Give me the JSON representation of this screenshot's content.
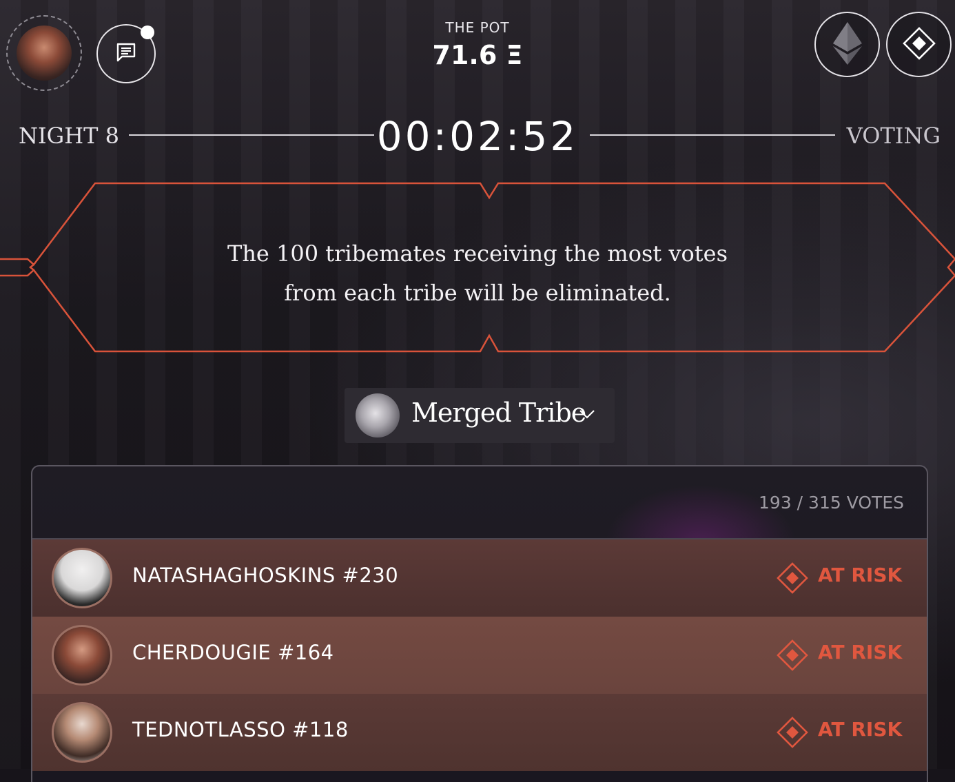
{
  "header": {
    "pot_label": "THE POT",
    "pot_value": "71.6 Ξ",
    "user_avatar_icon": "user-avatar",
    "chat_icon": "chat-icon",
    "eth_icon": "ethereum-icon",
    "diamond_icon": "diamond-icon"
  },
  "status": {
    "night": "NIGHT 8",
    "timer": "00:02:52",
    "phase": "VOTING"
  },
  "banner": {
    "message": "The 100 tribemates receiving the most votes from each tribe will be eliminated."
  },
  "tribe_select": {
    "selected": "Merged Tribe"
  },
  "voting_panel": {
    "votes_count": "193 / 315 VOTES",
    "rows": [
      {
        "name": "NATASHAGHOSKINS #230",
        "status": "AT RISK"
      },
      {
        "name": "CHERDOUGIE #164",
        "status": "AT RISK"
      },
      {
        "name": "TEDNOTLASSO #118",
        "status": "AT RISK"
      }
    ]
  },
  "colors": {
    "accent": "#e0573f",
    "banner_border": "#d9533a",
    "background": "#17141a"
  }
}
